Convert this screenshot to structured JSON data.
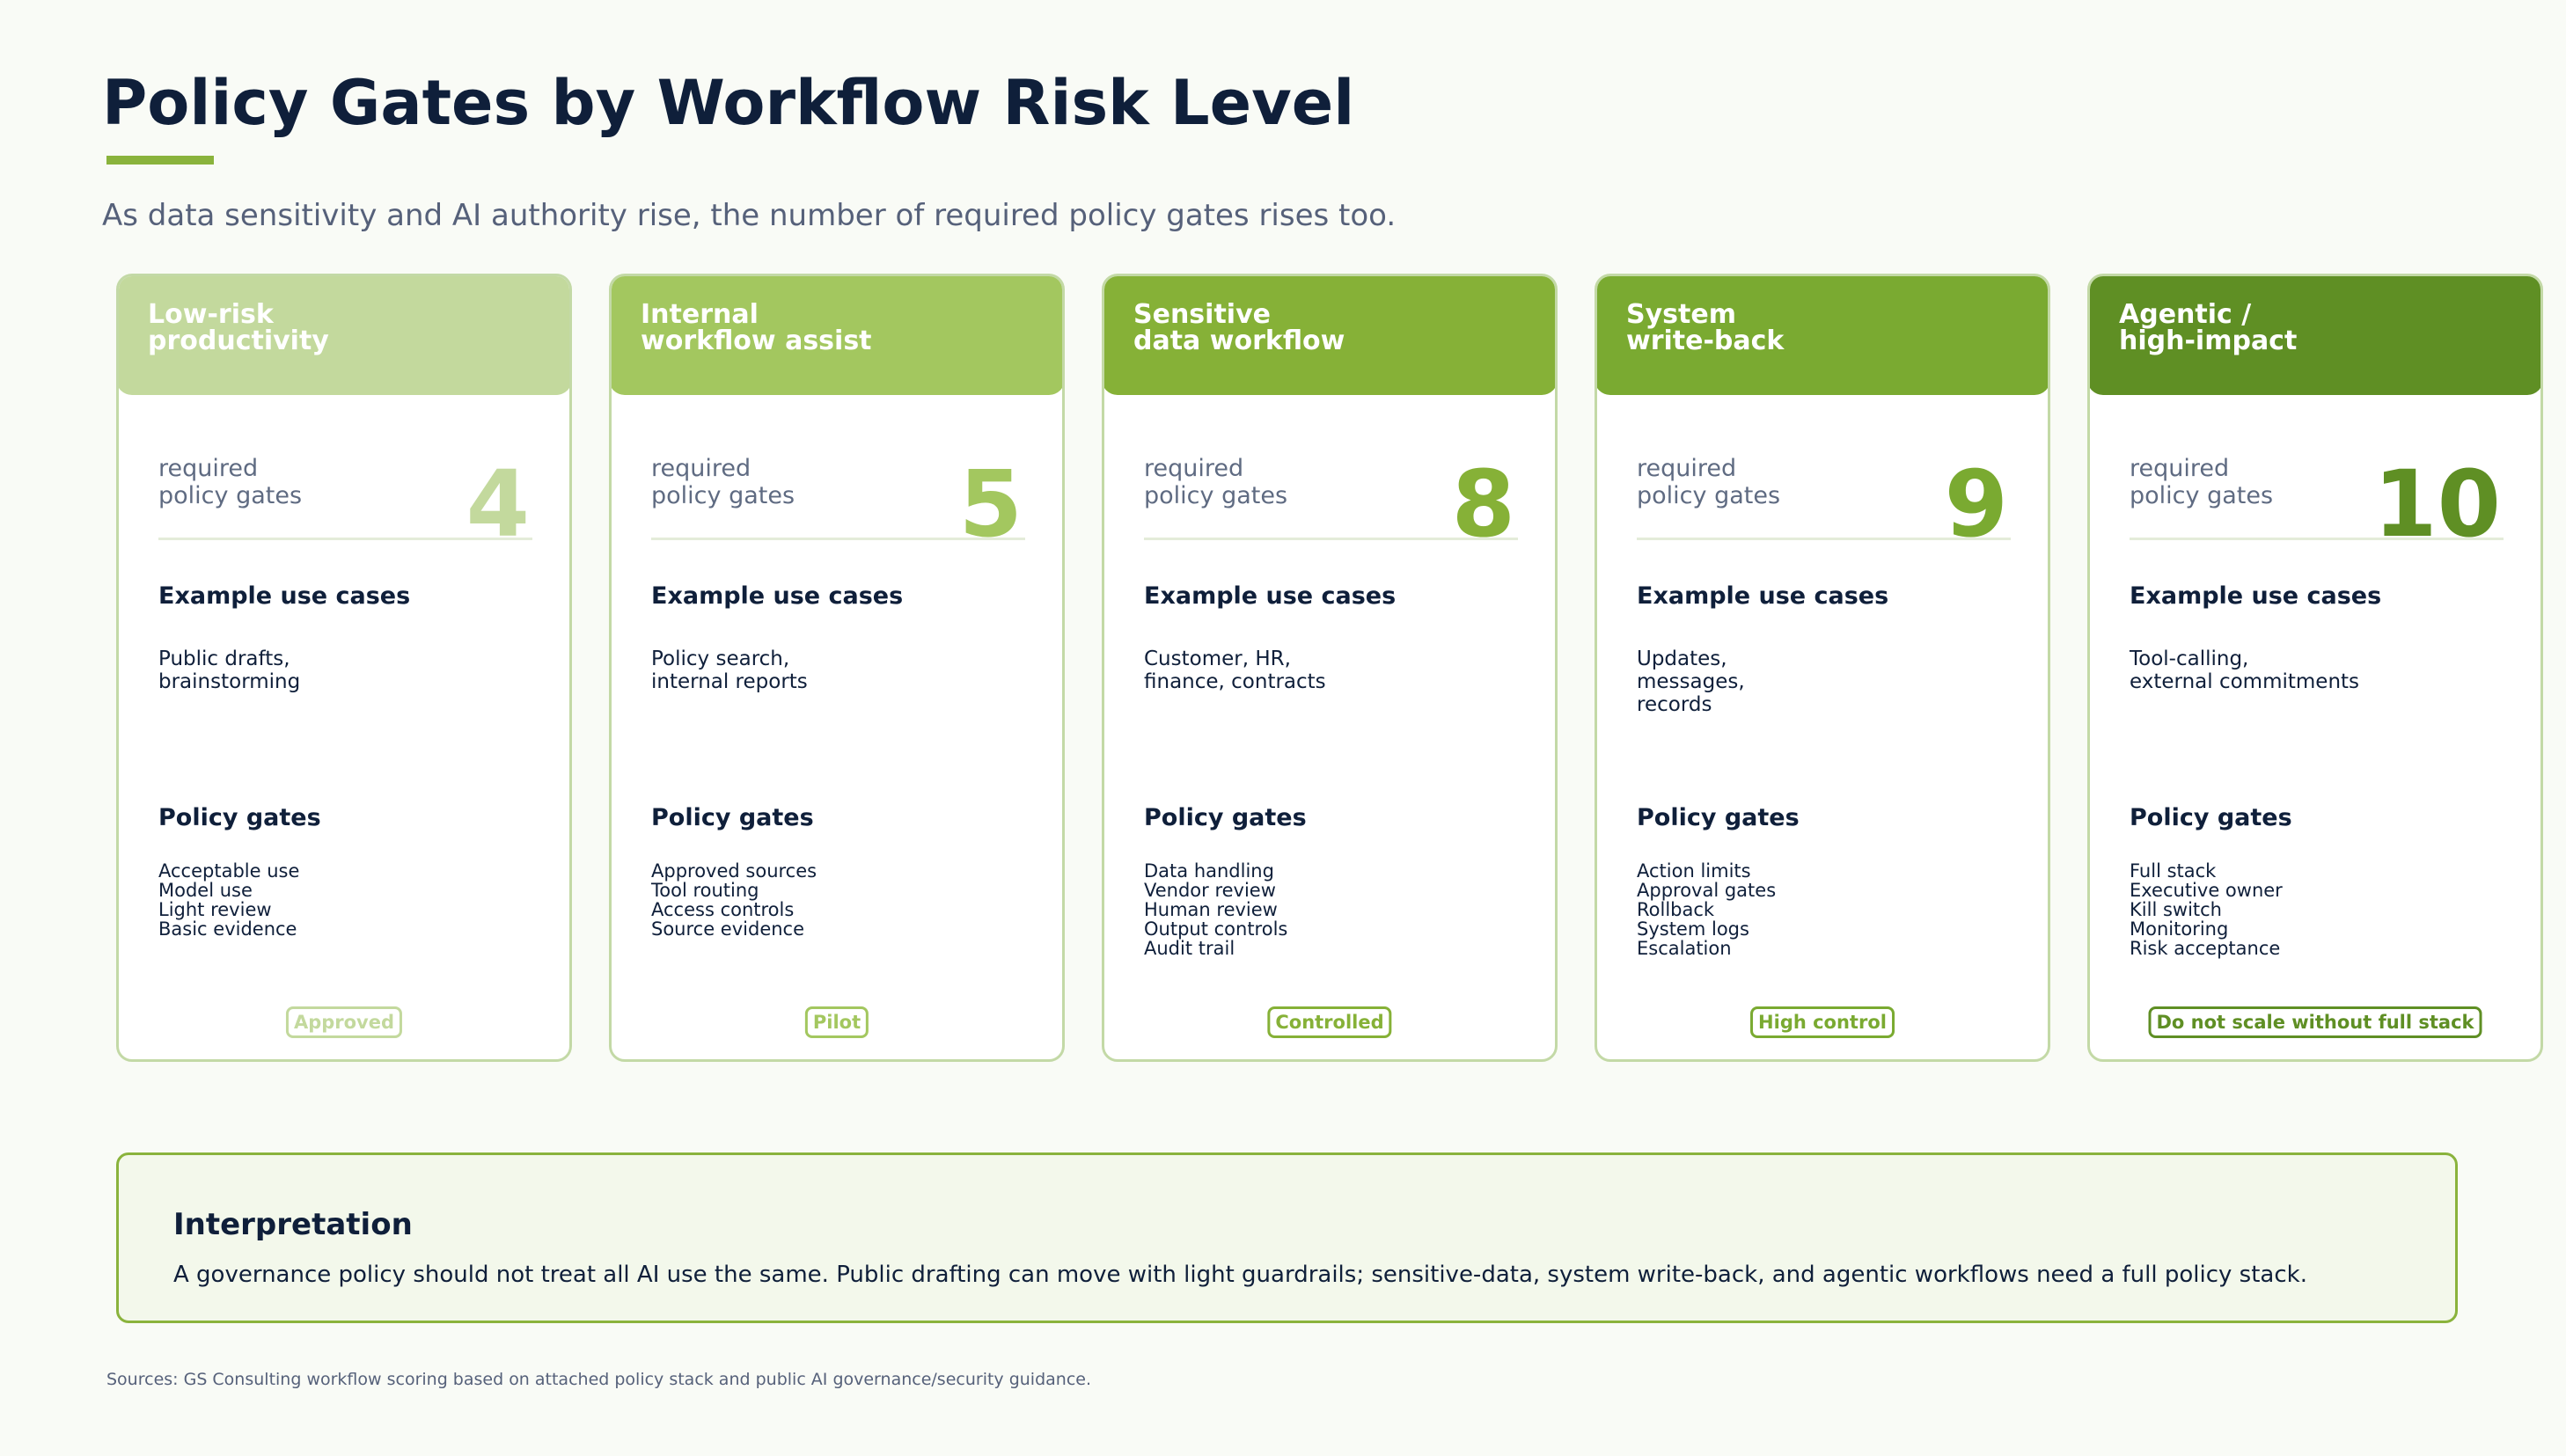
{
  "title": "Policy Gates by Workflow Risk Level",
  "subtitle": "As data sensitivity and AI authority rise, the number of required policy gates rises too.",
  "required_label": "required\npolicy gates",
  "uses_heading": "Example use cases",
  "gates_heading": "Policy gates",
  "cards": [
    {
      "header": "Low-risk\nproductivity",
      "color": "#c3d99d",
      "number": "4",
      "uses": "Public drafts,\nbrainstorming",
      "gates": [
        "Acceptable use",
        "Model use",
        "Light review",
        "Basic evidence"
      ],
      "status": "Approved"
    },
    {
      "header": "Internal\nworkflow assist",
      "color": "#a3c75f",
      "number": "5",
      "uses": "Policy search,\ninternal reports",
      "gates": [
        "Approved sources",
        "Tool routing",
        "Access controls",
        "Source evidence"
      ],
      "status": "Pilot"
    },
    {
      "header": "Sensitive\ndata workflow",
      "color": "#86b137",
      "number": "8",
      "uses": "Customer, HR,\nfinance, contracts",
      "gates": [
        "Data handling",
        "Vendor review",
        "Human review",
        "Output controls",
        "Audit trail"
      ],
      "status": "Controlled"
    },
    {
      "header": "System\nwrite-back",
      "color": "#7aaa31",
      "number": "9",
      "uses": "Updates,\nmessages,\nrecords",
      "gates": [
        "Action limits",
        "Approval gates",
        "Rollback",
        "System logs",
        "Escalation"
      ],
      "status": "High control"
    },
    {
      "header": "Agentic /\nhigh-impact",
      "color": "#5f8f24",
      "number": "10",
      "uses": "Tool-calling,\nexternal commitments",
      "gates": [
        "Full stack",
        "Executive owner",
        "Kill switch",
        "Monitoring",
        "Risk acceptance"
      ],
      "status": "Do not scale without full stack"
    }
  ],
  "interpretation": {
    "title": "Interpretation",
    "body": "A governance policy should not treat all AI use the same. Public drafting can move with light guardrails; sensitive-data, system write-back, and agentic workflows need a full policy stack."
  },
  "sources": "Sources: GS Consulting workflow scoring based on attached policy stack and public AI governance/security guidance."
}
